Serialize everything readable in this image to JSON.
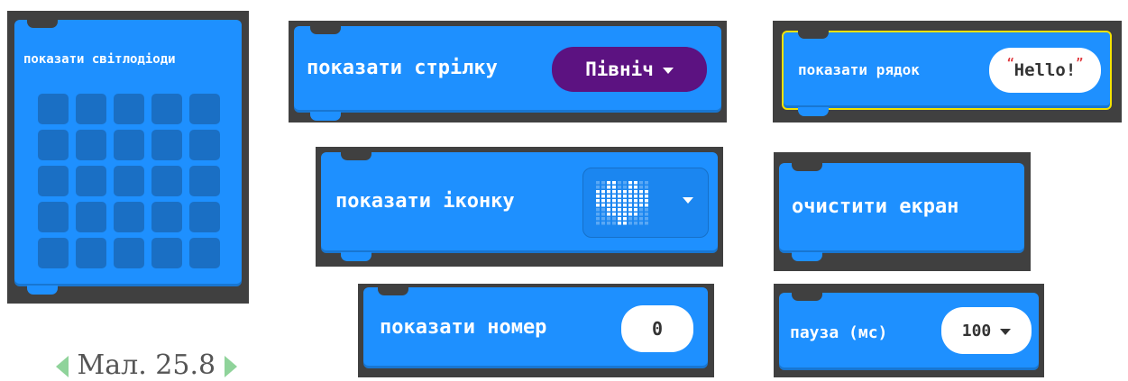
{
  "blocks": {
    "show_leds": {
      "label": "показати світлодіоди",
      "rows": 5,
      "cols": 5
    },
    "show_arrow": {
      "label": "показати стрілку",
      "value": "Північ"
    },
    "show_string": {
      "label": "показати рядок",
      "value": "Hello!"
    },
    "show_icon": {
      "label": "показати іконку",
      "icon": "heart-icon"
    },
    "clear_screen": {
      "label": "очистити екран"
    },
    "show_number": {
      "label": "показати номер",
      "value": "0"
    },
    "pause": {
      "label": "пауза (мс)",
      "value": "100"
    }
  },
  "caption": {
    "text": "Мал. 25.8"
  },
  "colors": {
    "block": "#1e90ff",
    "frame": "#404040",
    "arrow_dropdown": "#5c1281",
    "led_off": "#1a6fc4",
    "highlight": "#f2e200"
  }
}
